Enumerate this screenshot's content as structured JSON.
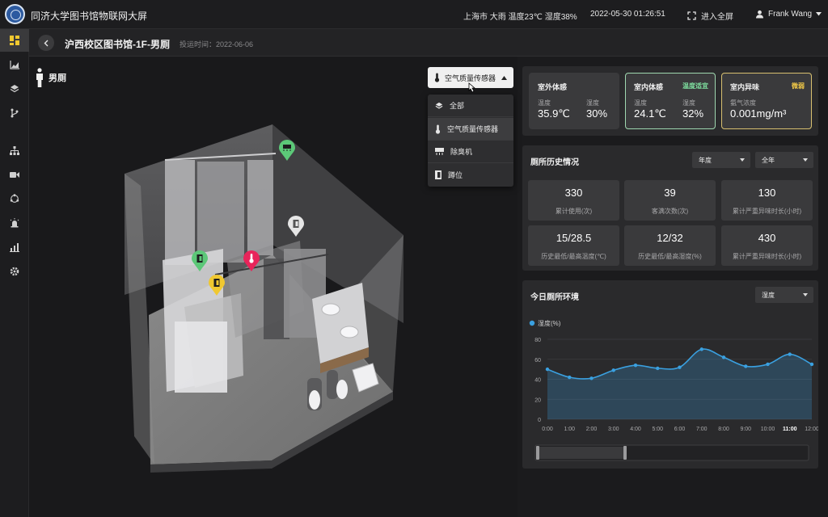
{
  "header": {
    "title": "同济大学图书馆物联网大屏",
    "weather": "上海市  大雨  温度23℃  湿度38%",
    "datetime": "2022-05-30  01:26:51",
    "fullscreen_label": "进入全屏",
    "user_name": "Frank Wang"
  },
  "subheader": {
    "title": "沪西校区图书馆-1F-男厕",
    "date": "投运时间：2022-06-06"
  },
  "room": {
    "label": "男厕"
  },
  "sensor_select": {
    "selected": "空气质量传感器",
    "options": [
      {
        "label": "全部",
        "icon": "layers-icon"
      },
      {
        "label": "空气质量传感器",
        "icon": "thermometer-icon"
      },
      {
        "label": "除臭机",
        "icon": "deodorizer-icon"
      },
      {
        "label": "蹲位",
        "icon": "door-icon"
      }
    ]
  },
  "cards": {
    "outdoor": {
      "title": "室外体感",
      "temp_label": "温度",
      "temp_value": "35.9℃",
      "hum_label": "湿度",
      "hum_value": "30%"
    },
    "indoor": {
      "title": "室内体感",
      "badge": "温度适宜",
      "temp_label": "温度",
      "temp_value": "24.1℃",
      "hum_label": "湿度",
      "hum_value": "32%"
    },
    "odor": {
      "title": "室内异味",
      "badge": "微弱",
      "gas_label": "氨气浓度",
      "gas_value": "0.001mg/m³"
    }
  },
  "history": {
    "title": "厕所历史情况",
    "period_select": "年度",
    "range_select": "全年",
    "stats": [
      {
        "value": "330",
        "label": "累计使用(次)"
      },
      {
        "value": "39",
        "label": "客满次数(次)"
      },
      {
        "value": "130",
        "label": "累计严重异味时长(小时)"
      },
      {
        "value": "15/28.5",
        "label": "历史最低/最高温度(℃)"
      },
      {
        "value": "12/32",
        "label": "历史最低/最高湿度(%)"
      },
      {
        "value": "430",
        "label": "累计严重异味时长(小时)"
      }
    ]
  },
  "today": {
    "title": "今日厕所环境",
    "metric_select": "湿度"
  },
  "colors": {
    "accent_line": "#3aa0e0",
    "indoor_border": "#9fd8b0",
    "indoor_badge": "#7fe0a0",
    "odor_border": "#d8c070",
    "odor_badge": "#f0c848",
    "pin_green": "#5cc878",
    "pin_red": "#e8245a",
    "pin_yellow": "#f0c830",
    "pin_gray": "#e6e6e6"
  },
  "chart_data": {
    "type": "area",
    "legend": "湿度(%)",
    "x": [
      "0:00",
      "1:00",
      "2:00",
      "3:00",
      "4:00",
      "5:00",
      "6:00",
      "7:00",
      "8:00",
      "9:00",
      "10:00",
      "11:00",
      "12:00"
    ],
    "series": [
      {
        "name": "湿度(%)",
        "values": [
          50,
          42,
          41,
          49,
          54,
          51,
          52,
          70,
          62,
          53,
          55,
          65,
          55
        ]
      }
    ],
    "ylim": [
      0,
      80
    ],
    "yticks": [
      0,
      20,
      40,
      60,
      80
    ],
    "highlight_x": "11:00",
    "grid": true,
    "legend_position": "top-left"
  }
}
